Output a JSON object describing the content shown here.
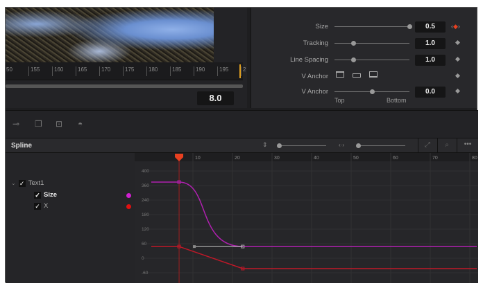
{
  "viewer": {
    "ruler_ticks": [
      "50",
      "155",
      "160",
      "165",
      "170",
      "175",
      "180",
      "185",
      "190",
      "195",
      "2"
    ],
    "value": "8.0"
  },
  "inspector": {
    "size": {
      "label": "Size",
      "value": "0.5",
      "slider": 1.0
    },
    "tracking": {
      "label": "Tracking",
      "value": "1.0",
      "slider": 0.25
    },
    "line_spacing": {
      "label": "Line Spacing",
      "value": "1.0",
      "slider": 0.25
    },
    "v_anchor_align": {
      "label": "V Anchor"
    },
    "v_anchor": {
      "label": "V Anchor",
      "value": "0.0",
      "slider": 0.5,
      "min_label": "Top",
      "max_label": "Bottom"
    }
  },
  "spline": {
    "title": "Spline",
    "tree": {
      "parent": "Text1",
      "children": [
        {
          "label": "Size",
          "color": "#d020d0"
        },
        {
          "label": "X",
          "color": "#e01010"
        }
      ]
    }
  },
  "graph": {
    "x_ticks": [
      "10",
      "20",
      "30",
      "40",
      "50",
      "60",
      "70",
      "80"
    ],
    "y_ticks": [
      "400",
      "360",
      "240",
      "180",
      "120",
      "60",
      "0",
      "-60"
    ],
    "playhead_frame": 6.5,
    "curves": [
      {
        "name": "Size",
        "color": "#b020b0",
        "keyframes": [
          [
            6.5,
            340
          ],
          [
            22.6,
            74
          ]
        ]
      },
      {
        "name": "X",
        "color": "#c01828",
        "keyframes": [
          [
            6.5,
            74
          ],
          [
            22.6,
            -17
          ]
        ]
      }
    ]
  }
}
